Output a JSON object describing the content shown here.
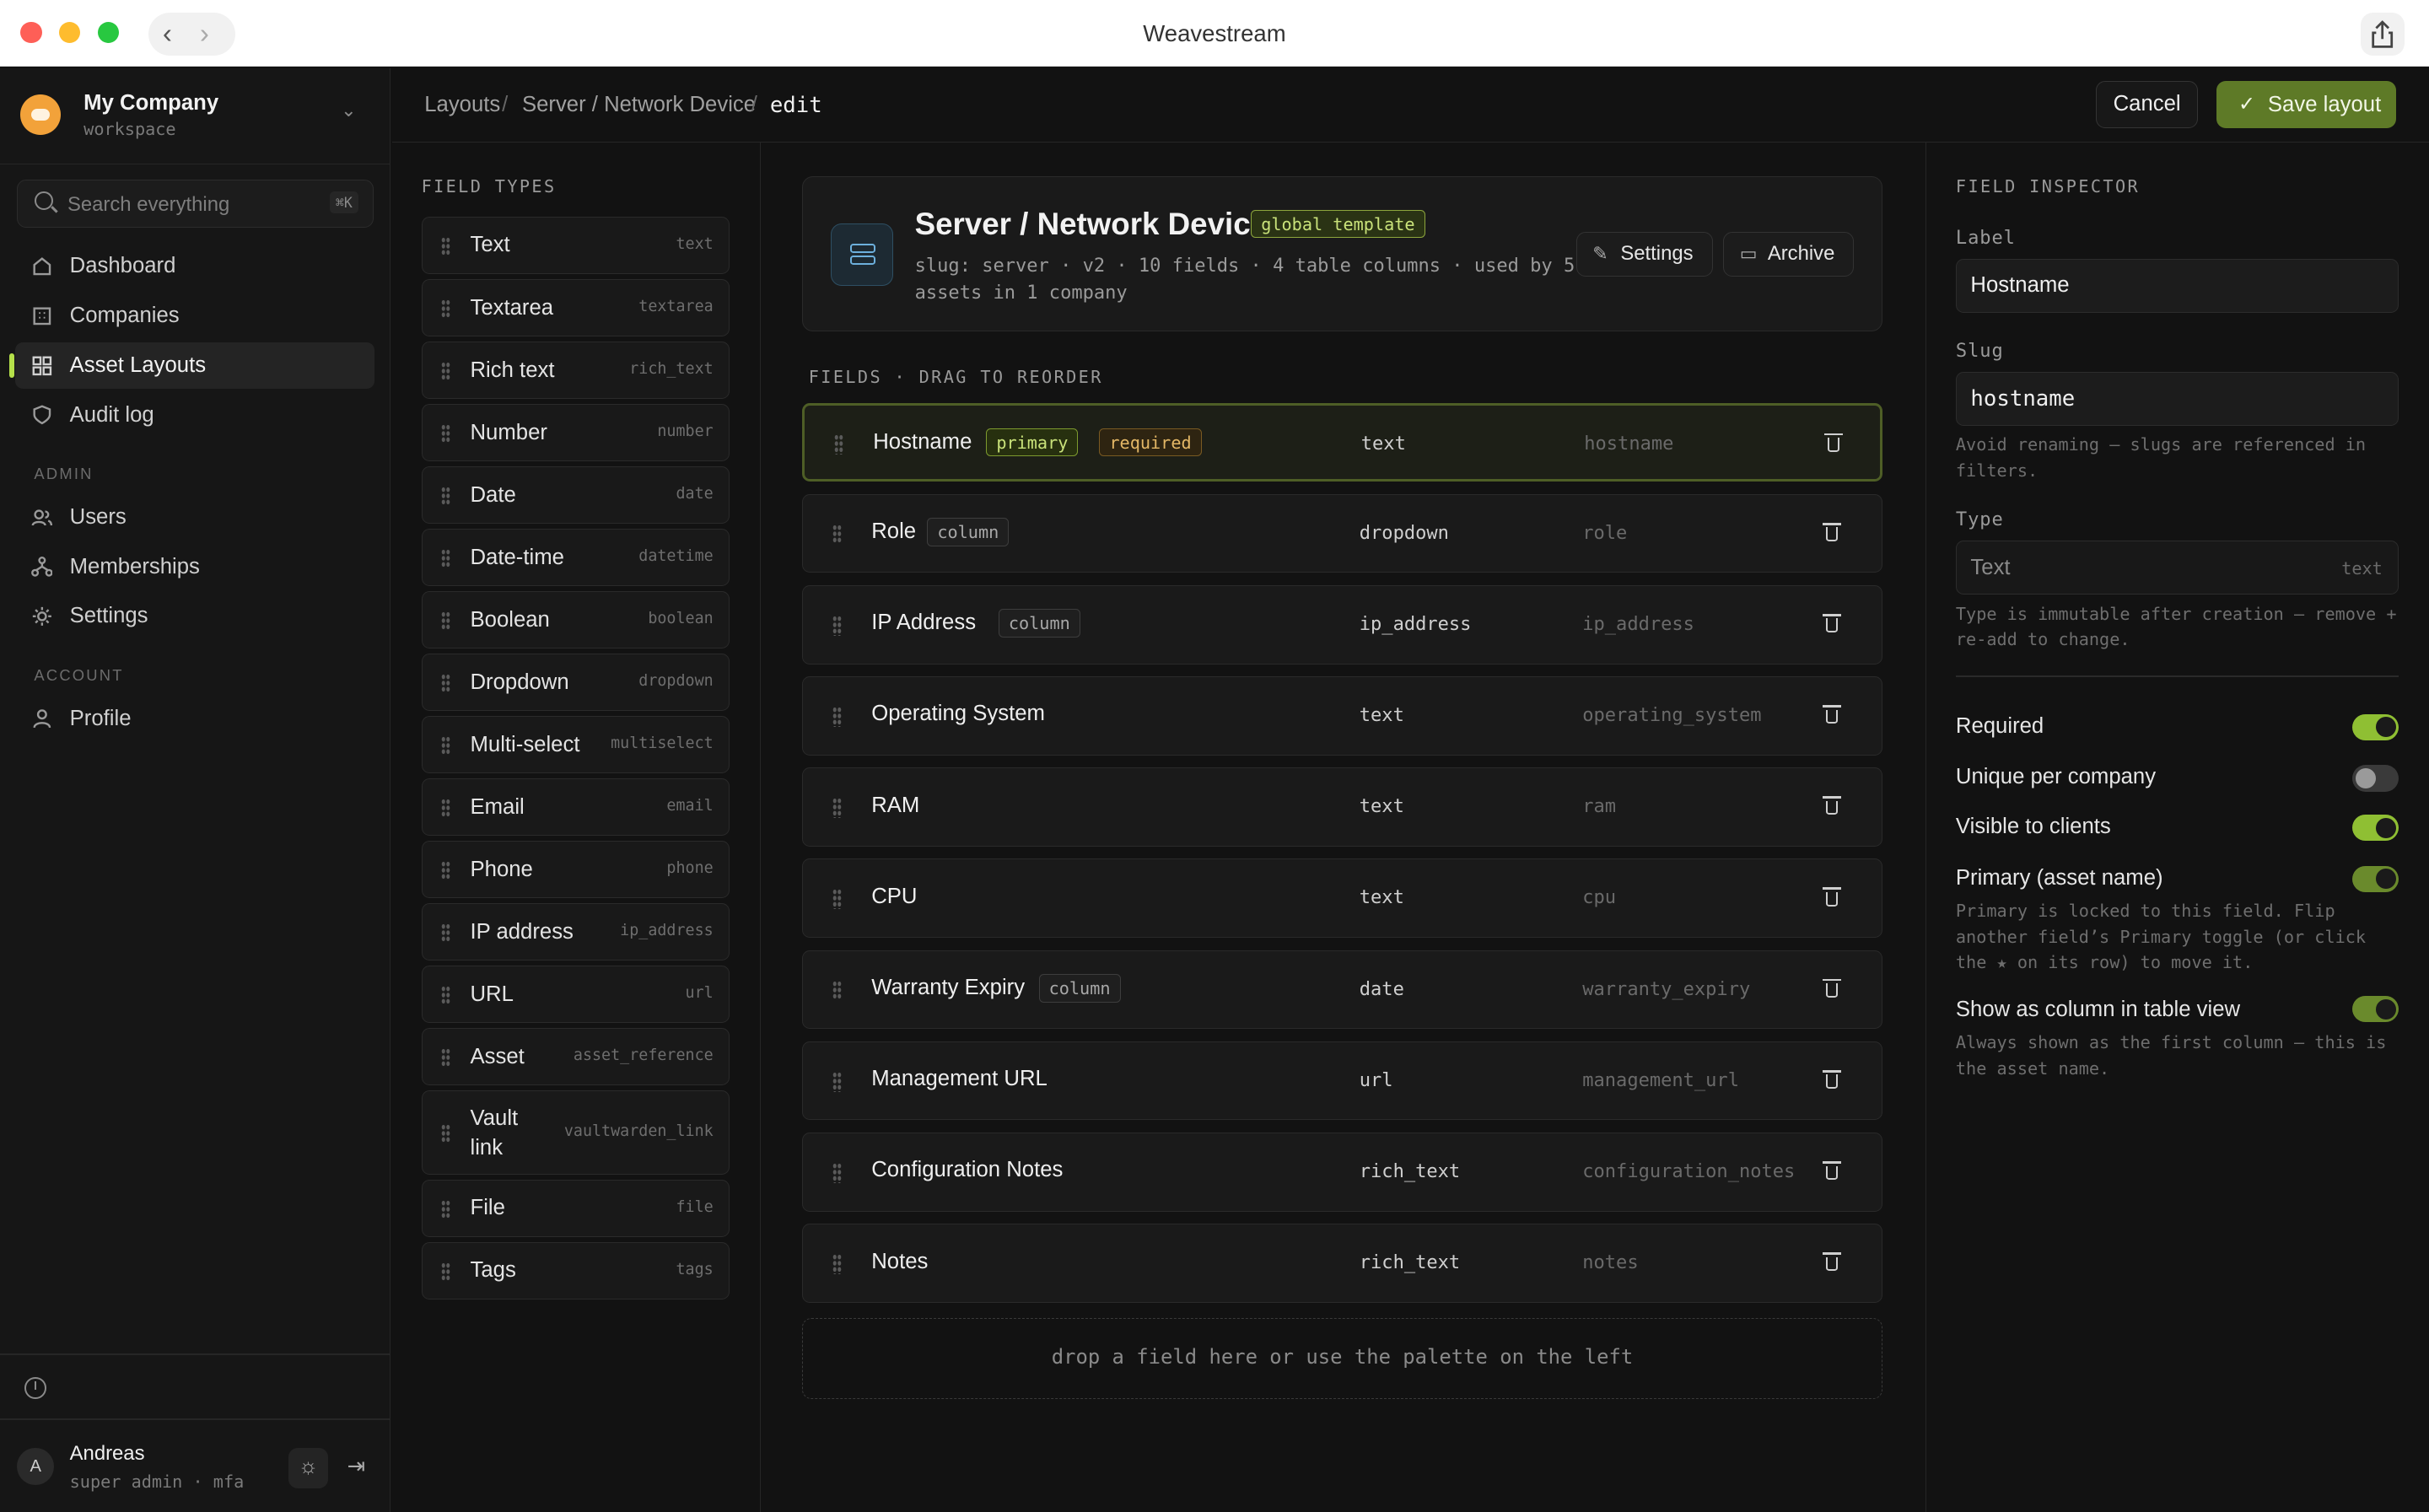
{
  "window": {
    "title": "Weavestream"
  },
  "workspace": {
    "name": "My Company",
    "sub": "workspace"
  },
  "search": {
    "placeholder": "Search everything",
    "shortcut": "⌘K"
  },
  "nav": {
    "items": [
      {
        "label": "Dashboard",
        "icon": "home-icon"
      },
      {
        "label": "Companies",
        "icon": "building-icon"
      },
      {
        "label": "Asset Layouts",
        "icon": "grid-icon",
        "active": true
      },
      {
        "label": "Audit log",
        "icon": "shield-icon"
      }
    ],
    "admin_header": "ADMIN",
    "admin": [
      {
        "label": "Users",
        "icon": "users-icon"
      },
      {
        "label": "Memberships",
        "icon": "branch-icon"
      },
      {
        "label": "Settings",
        "icon": "gear-icon"
      }
    ],
    "account_header": "ACCOUNT",
    "account": [
      {
        "label": "Profile",
        "icon": "user-icon"
      }
    ]
  },
  "user": {
    "initial": "A",
    "name": "Andreas",
    "role": "super admin · mfa"
  },
  "breadcrumb": {
    "c1": "Layouts",
    "sep": "/",
    "c2": "Server / Network Device",
    "c3": "edit"
  },
  "actions": {
    "cancel": "Cancel",
    "save": "Save layout"
  },
  "palette": {
    "title": "FIELD TYPES",
    "items": [
      {
        "label": "Text",
        "code": "text"
      },
      {
        "label": "Textarea",
        "code": "textarea"
      },
      {
        "label": "Rich text",
        "code": "rich_text"
      },
      {
        "label": "Number",
        "code": "number"
      },
      {
        "label": "Date",
        "code": "date"
      },
      {
        "label": "Date-time",
        "code": "datetime"
      },
      {
        "label": "Boolean",
        "code": "boolean"
      },
      {
        "label": "Dropdown",
        "code": "dropdown"
      },
      {
        "label": "Multi-select",
        "code": "multiselect"
      },
      {
        "label": "Email",
        "code": "email"
      },
      {
        "label": "Phone",
        "code": "phone"
      },
      {
        "label": "IP address",
        "code": "ip_address"
      },
      {
        "label": "URL",
        "code": "url"
      },
      {
        "label": "Asset",
        "code": "asset_reference"
      },
      {
        "label": "Vault link",
        "code": "vaultwarden_link"
      },
      {
        "label": "File",
        "code": "file"
      },
      {
        "label": "Tags",
        "code": "tags"
      }
    ]
  },
  "layout": {
    "title": "Server / Network Device",
    "badge": "global template",
    "meta": "slug: server · v2 · 10 fields · 4 table columns · used by 5 assets in 1 company",
    "settings": "Settings",
    "archive": "Archive"
  },
  "fields": {
    "title": "FIELDS · DRAG TO REORDER",
    "tag_primary": "primary",
    "tag_required": "required",
    "tag_column": "column",
    "rows": [
      {
        "name": "Hostname",
        "type": "text",
        "slug": "hostname"
      },
      {
        "name": "Role",
        "type": "dropdown",
        "slug": "role"
      },
      {
        "name": "IP Address",
        "type": "ip_address",
        "slug": "ip_address"
      },
      {
        "name": "Operating System",
        "type": "text",
        "slug": "operating_system"
      },
      {
        "name": "RAM",
        "type": "text",
        "slug": "ram"
      },
      {
        "name": "CPU",
        "type": "text",
        "slug": "cpu"
      },
      {
        "name": "Warranty Expiry",
        "type": "date",
        "slug": "warranty_expiry"
      },
      {
        "name": "Management URL",
        "type": "url",
        "slug": "management_url"
      },
      {
        "name": "Configuration Notes",
        "type": "rich_text",
        "slug": "configuration_notes"
      },
      {
        "name": "Notes",
        "type": "rich_text",
        "slug": "notes"
      }
    ],
    "drop": "drop a field here or use the palette on the left"
  },
  "inspector": {
    "title": "FIELD INSPECTOR",
    "label_label": "Label",
    "label_value": "Hostname",
    "slug_label": "Slug",
    "slug_value": "hostname",
    "slug_help": "Avoid renaming — slugs are referenced in filters.",
    "type_label": "Type",
    "type_value": "Text",
    "type_code": "text",
    "type_help": "Type is immutable after creation — remove + re-add to change.",
    "toggles": [
      {
        "label": "Required",
        "on": true
      },
      {
        "label": "Unique per company",
        "on": false
      },
      {
        "label": "Visible to clients",
        "on": true
      },
      {
        "label": "Primary (asset name)",
        "on": true
      },
      {
        "label": "Show as column in table view",
        "on": true
      }
    ],
    "primary_help": "Primary is locked to this field. Flip another field’s Primary toggle (or click the ★ on its row) to move it.",
    "column_help": "Always shown as the first column — this is the asset name."
  },
  "colors": {
    "accent": "#8fbf33",
    "save": "#5e7a27",
    "required": "#e3b766",
    "primary": "#c9e27a"
  }
}
